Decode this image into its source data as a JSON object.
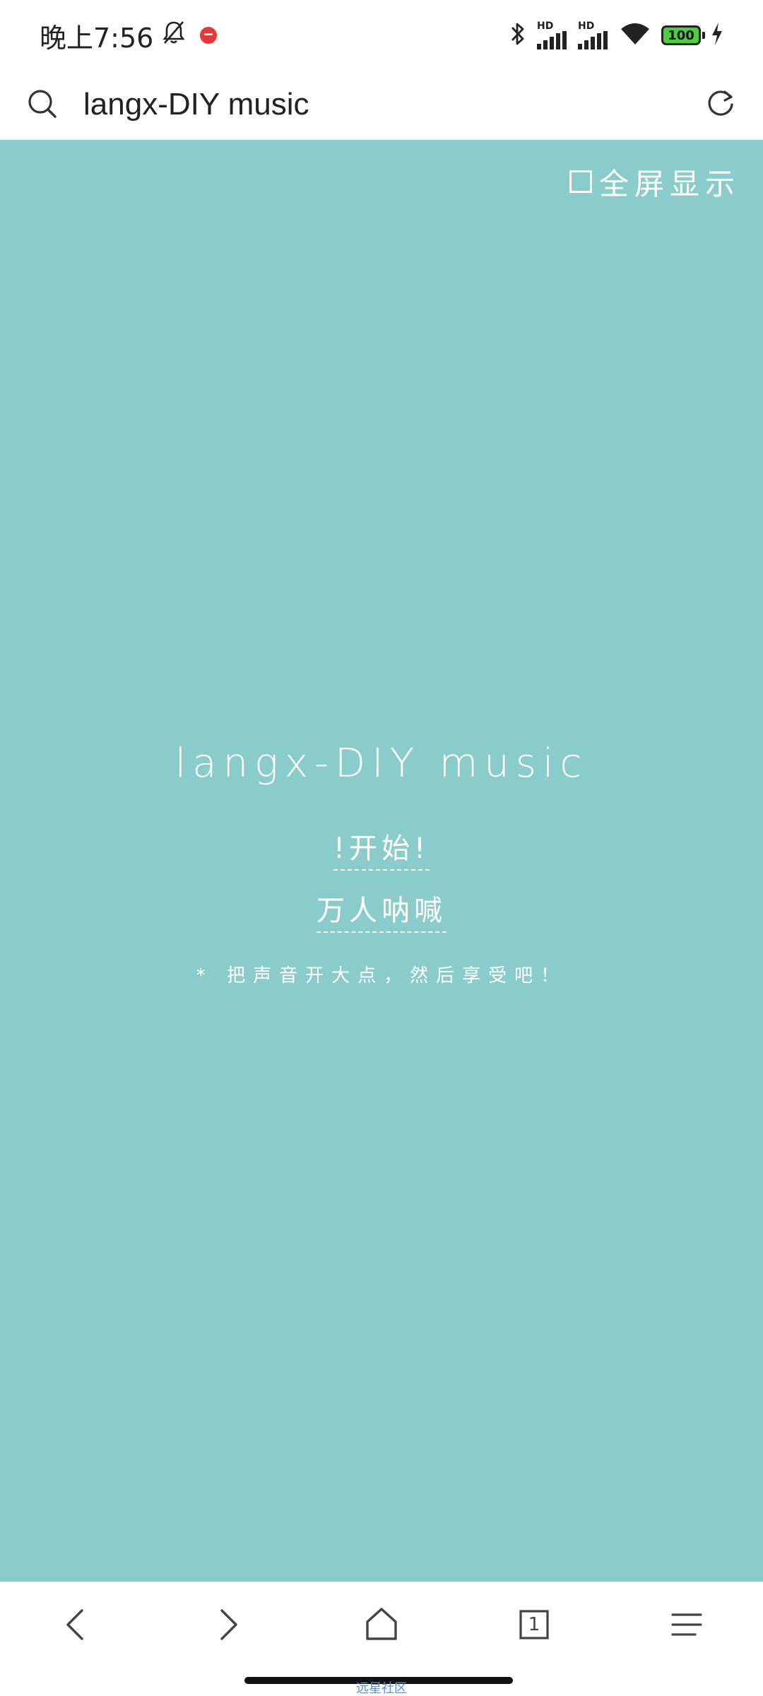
{
  "status_bar": {
    "time": "晚上7:56",
    "icons": [
      "bell-off-icon",
      "app-notification-icon",
      "bluetooth-icon",
      "signal-hd-1-icon",
      "signal-hd-2-icon",
      "wifi-icon",
      "battery-icon",
      "charging-icon"
    ],
    "signal_label_1": "HD",
    "signal_label_2": "HD",
    "battery_level": "100",
    "battery_color": "#4ccf3f"
  },
  "address_bar": {
    "url_text": "langx-DIY music",
    "left_icon": "search-icon",
    "right_icon": "reload-icon"
  },
  "page": {
    "background_color": "#89cccb",
    "fullscreen_label": "全屏显示",
    "title": "langx-DIY music",
    "start_link": "!开始!",
    "shout_link": "万人呐喊",
    "hint": "* 把声音开大点，然后享受吧！"
  },
  "bottom_nav": {
    "items": [
      "back-icon",
      "forward-icon",
      "home-icon",
      "tabs-icon",
      "menu-icon"
    ],
    "tab_count": "1"
  },
  "footer": {
    "link_text": "远星社区"
  }
}
